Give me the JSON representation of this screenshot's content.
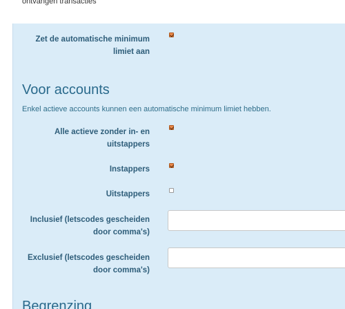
{
  "top": {
    "text": "ontvangen transacties"
  },
  "automatic": {
    "label": "Zet de automatische minimum limiet aan",
    "checked": true
  },
  "accounts": {
    "title": "Voor accounts",
    "description": "Enkel actieve accounts kunnen een automatische minimum limiet hebben.",
    "rows": [
      {
        "label": "Alle actieve zonder in- en uitstappers",
        "checked": true
      },
      {
        "label": "Instappers",
        "checked": true
      },
      {
        "label": "Uitstappers",
        "checked": false
      }
    ],
    "inclusive": {
      "label": "Inclusief (letscodes gescheiden door comma's)",
      "value": ""
    },
    "exclusive": {
      "label": "Exclusief (letscodes gescheiden door comma's)",
      "value": ""
    }
  },
  "next_section": {
    "title": "Begrenzing"
  }
}
